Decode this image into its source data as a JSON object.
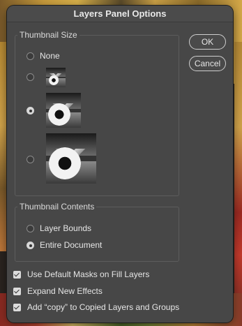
{
  "dialog": {
    "title": "Layers Panel Options",
    "ok_label": "OK",
    "cancel_label": "Cancel"
  },
  "thumbnail_size": {
    "title": "Thumbnail Size",
    "options": [
      {
        "label": "None",
        "selected": false
      },
      {
        "label": "",
        "size": "small",
        "selected": false
      },
      {
        "label": "",
        "size": "medium",
        "selected": true
      },
      {
        "label": "",
        "size": "large",
        "selected": false
      }
    ]
  },
  "thumbnail_contents": {
    "title": "Thumbnail Contents",
    "options": [
      {
        "label": "Layer Bounds",
        "selected": false
      },
      {
        "label": "Entire Document",
        "selected": true
      }
    ]
  },
  "checkboxes": [
    {
      "label": "Use Default Masks on Fill Layers",
      "checked": true
    },
    {
      "label": "Expand New Effects",
      "checked": true
    },
    {
      "label": "Add “copy” to Copied Layers and Groups",
      "checked": true
    }
  ]
}
